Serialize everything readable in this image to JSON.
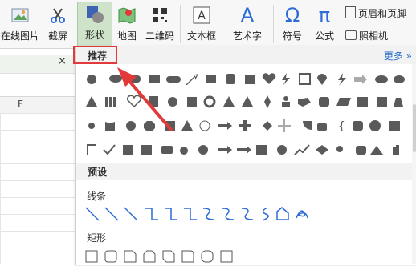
{
  "ribbon": {
    "online_image": "在线图片",
    "screenshot": "截屏",
    "shapes": "形状",
    "map": "地图",
    "qrcode": "二维码",
    "textbox": "文本框",
    "wordart": "艺术字",
    "symbol": "符号",
    "formula": "公式",
    "header_footer": "页眉和页脚",
    "camera": "照相机",
    "wordart_glyph": "A",
    "symbol_glyph": "Ω",
    "formula_glyph": "π"
  },
  "document": {
    "close": "×",
    "column_header": "F"
  },
  "panel": {
    "recommended": "推荐",
    "more": "更多",
    "presets": "预设",
    "lines": "线条",
    "rectangles": "矩形"
  },
  "colors": {
    "accent": "#e23a3a",
    "shape_fill": "#5a5a5a",
    "line_blue": "#2d6bd6"
  }
}
